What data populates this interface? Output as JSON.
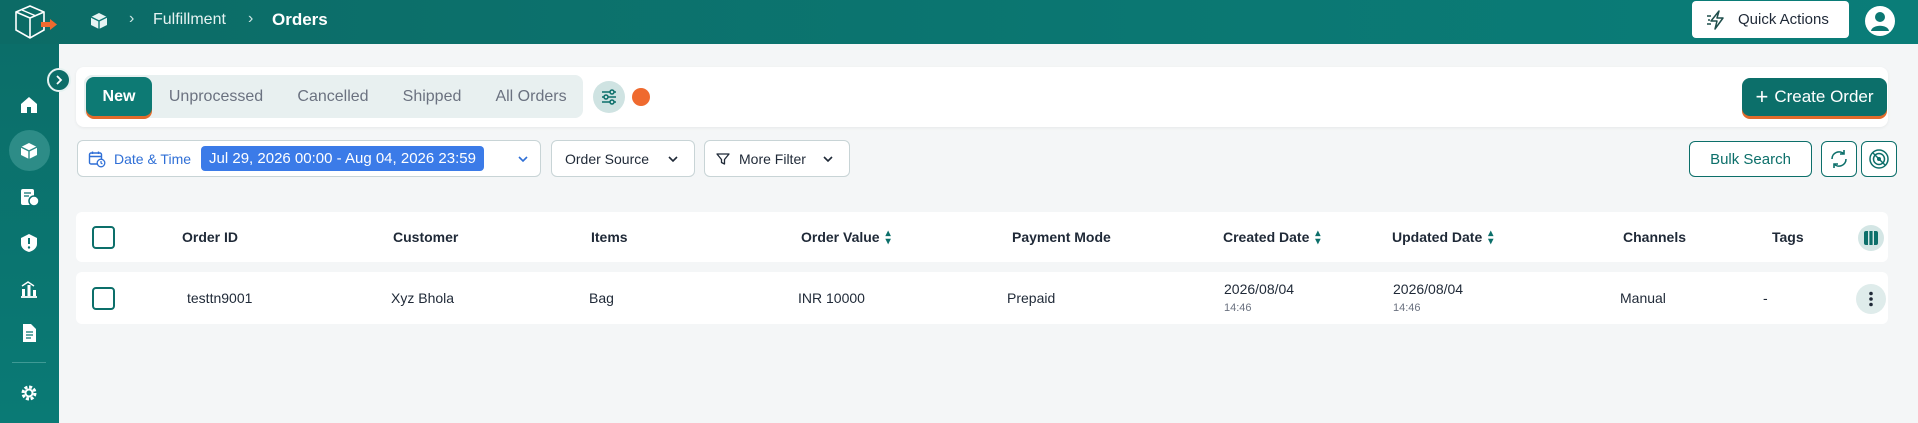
{
  "breadcrumb": {
    "section": "Fulfillment",
    "page": "Orders",
    "separator": "›"
  },
  "header": {
    "quick_actions_label": "Quick Actions"
  },
  "tabs": [
    {
      "label": "New",
      "active": true
    },
    {
      "label": "Unprocessed"
    },
    {
      "label": "Cancelled"
    },
    {
      "label": "Shipped"
    },
    {
      "label": "All Orders"
    }
  ],
  "actions": {
    "create_order_label": "Create Order",
    "create_order_icon": "+"
  },
  "filters": {
    "date_label": "Date & Time",
    "date_range": "Jul 29, 2026 00:00 - Aug 04, 2026 23:59",
    "order_source_label": "Order Source",
    "more_filter_label": "More Filter",
    "bulk_search_label": "Bulk Search"
  },
  "table": {
    "columns": [
      "Order ID",
      "Customer",
      "Items",
      "Order Value",
      "Payment Mode",
      "Created Date",
      "Updated Date",
      "Channels",
      "Tags"
    ],
    "rows": [
      {
        "order_id": "testtn9001",
        "customer": "Xyz Bhola",
        "items": "Bag",
        "order_value": "INR 10000",
        "payment_mode": "Prepaid",
        "created_date": "2026/08/04",
        "created_time": "14:46",
        "updated_date": "2026/08/04",
        "updated_time": "14:46",
        "channels": "Manual",
        "tags": "-"
      }
    ]
  },
  "colors": {
    "brand": "#0c6f6a",
    "accent": "#ef6a2f",
    "link": "#2f6fd6",
    "date_chip": "#3b7be8"
  }
}
